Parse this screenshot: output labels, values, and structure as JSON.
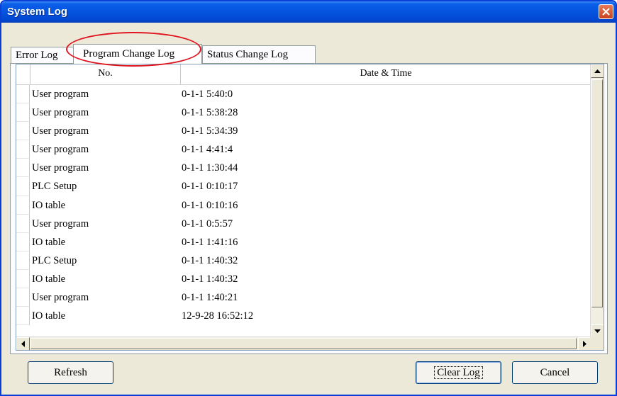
{
  "window": {
    "title": "System Log"
  },
  "tabs": [
    {
      "label": "Error Log"
    },
    {
      "label": "Program Change Log"
    },
    {
      "label": "Status Change Log"
    }
  ],
  "table": {
    "columns": [
      "No.",
      "Date & Time"
    ],
    "rows": [
      [
        "User program",
        "0-1-1  5:40:0"
      ],
      [
        "User program",
        "0-1-1  5:38:28"
      ],
      [
        "User program",
        "0-1-1  5:34:39"
      ],
      [
        "User program",
        "0-1-1  4:41:4"
      ],
      [
        "User program",
        "0-1-1  1:30:44"
      ],
      [
        "PLC Setup",
        "0-1-1  0:10:17"
      ],
      [
        "IO table",
        "0-1-1  0:10:16"
      ],
      [
        "User program",
        "0-1-1  0:5:57"
      ],
      [
        "IO table",
        "0-1-1  1:41:16"
      ],
      [
        "PLC Setup",
        "0-1-1  1:40:32"
      ],
      [
        "IO table",
        "0-1-1  1:40:32"
      ],
      [
        "User program",
        "0-1-1  1:40:21"
      ],
      [
        "IO table",
        "12-9-28  16:52:12"
      ]
    ]
  },
  "buttons": {
    "refresh": "Refresh",
    "clear_log": "Clear Log",
    "cancel": "Cancel"
  },
  "annotation": {
    "color": "#e0141e"
  }
}
